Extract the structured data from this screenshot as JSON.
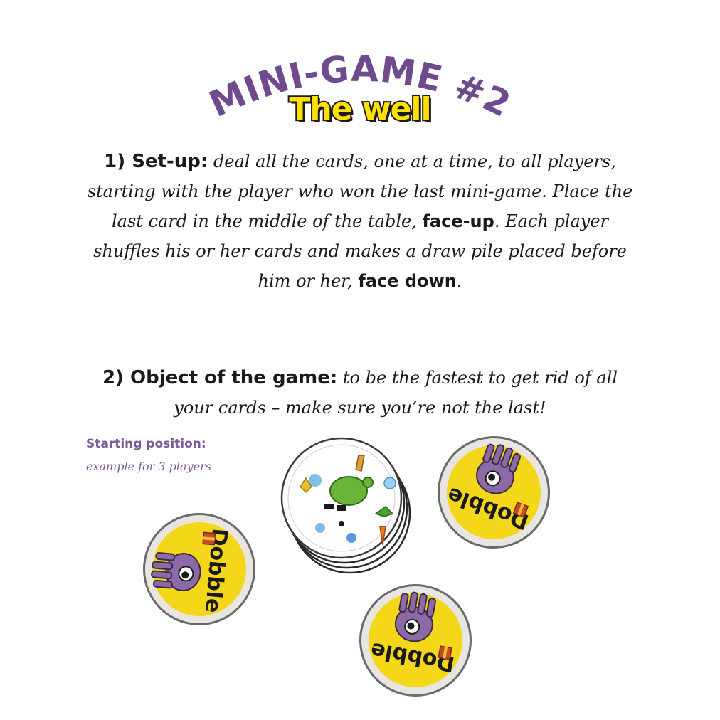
{
  "title": "MINI-GAME #2",
  "subtitle": "The well",
  "setup": {
    "heading": "1) Set-up:",
    "text_1": " deal all the cards, one at a time, to all players, starting with the player who won the last mini-game. Place the last card in the middle of the table, ",
    "bold_1": "face-up",
    "text_2": ". Each player shuffles his or her cards and makes a draw pile placed before him or her, ",
    "bold_2": "face down",
    "text_3": "."
  },
  "objective": {
    "heading": "2) Object of the game:",
    "text": " to be the fastest to get rid of all your cards – make sure you’re not the last!"
  },
  "illustration": {
    "label": "Starting position:",
    "caption": "example for 3 players",
    "card_brand": "Dobble",
    "colors": {
      "card_yellow": "#f3d718",
      "card_rim": "#e9e6e1",
      "mascot_purple": "#8c6aa6",
      "title_purple": "#6f4a8e"
    }
  }
}
